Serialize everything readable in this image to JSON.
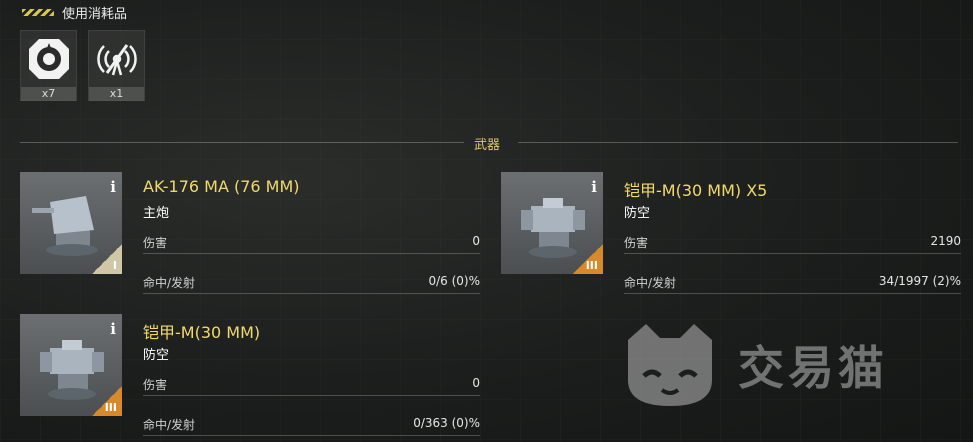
{
  "consumables": {
    "title": "使用消耗品",
    "items": [
      {
        "icon": "repair-kit-icon",
        "count": "x7"
      },
      {
        "icon": "jammer-antenna-icon",
        "count": "x1"
      }
    ]
  },
  "weapons_section": {
    "title": "武器",
    "items": [
      {
        "name": "AK-176 MA (76 MM)",
        "type": "主炮",
        "tier": "I",
        "damage_label": "伤害",
        "damage": "0",
        "accuracy_label": "命中/发射",
        "accuracy": "0/6 (0)%"
      },
      {
        "name": "铠甲-M(30 MM) X5",
        "type": "防空",
        "tier": "III",
        "damage_label": "伤害",
        "damage": "2190",
        "accuracy_label": "命中/发射",
        "accuracy": "34/1997 (2)%"
      },
      {
        "name": "铠甲-M(30 MM)",
        "type": "防空",
        "tier": "III",
        "damage_label": "伤害",
        "damage": "0",
        "accuracy_label": "命中/发射",
        "accuracy": "0/363 (0)%"
      }
    ]
  },
  "watermark": {
    "text": "交易猫"
  },
  "colors": {
    "accent": "#f2d96c",
    "tier_orange": "#d88a2a",
    "tier_light": "#cfc7a6"
  }
}
